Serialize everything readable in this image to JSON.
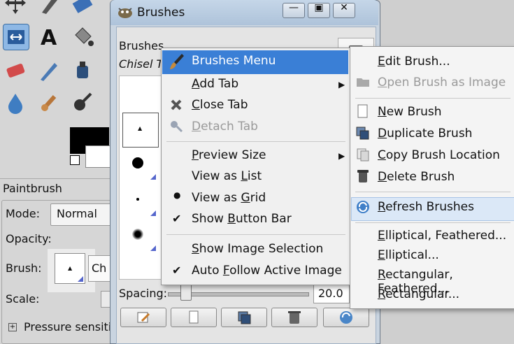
{
  "brushes_window": {
    "title": "Brushes",
    "header_label": "Brushes",
    "subheader_label": "Chisel T",
    "spacing_label": "Spacing:",
    "spacing_value": "20.0"
  },
  "tool_options": {
    "title": "Paintbrush",
    "mode_label": "Mode:",
    "mode_value": "Normal",
    "opacity_label": "Opacity:",
    "brush_label": "Brush:",
    "brush_name": "Ch",
    "scale_label": "Scale:",
    "pressure_label": "Pressure sensiti"
  },
  "context_menu": {
    "header": "Brushes Menu",
    "items": [
      {
        "label": "Add Tab",
        "mnemonic": "A",
        "rest": "dd Tab",
        "submenu": true
      },
      {
        "label": "Close Tab",
        "mnemonic": "C",
        "rest": "lose Tab"
      },
      {
        "label": "Detach Tab",
        "mnemonic": "D",
        "rest": "etach Tab",
        "disabled": true
      },
      {
        "label": "Preview Size",
        "mnemonic": "P",
        "rest": "review Size",
        "submenu": true
      },
      {
        "label": "View as List",
        "mnemonic": "L",
        "pre": "View as ",
        "rest": "ist"
      },
      {
        "label": "View as Grid",
        "mnemonic": "G",
        "pre": "View as ",
        "rest": "rid",
        "radio": true
      },
      {
        "label": "Show Button Bar",
        "mnemonic": "B",
        "pre": "Show ",
        "rest": "utton Bar",
        "checked": true
      },
      {
        "label": "Show Image Selection",
        "mnemonic": "S",
        "rest": "how Image Selection"
      },
      {
        "label": "Auto Follow Active Image",
        "mnemonic": "F",
        "pre": "Auto ",
        "rest": "ollow Active Image",
        "checked": true
      }
    ]
  },
  "brushes_submenu": {
    "items": [
      {
        "label": "Edit Brush...",
        "mnemonic": "E",
        "rest": "dit Brush..."
      },
      {
        "label": "Open Brush as Image",
        "mnemonic": "O",
        "rest": "pen Brush as Image",
        "disabled": true
      },
      {
        "label": "New Brush",
        "mnemonic": "N",
        "rest": "ew Brush"
      },
      {
        "label": "Duplicate Brush",
        "mnemonic": "D",
        "rest": "uplicate Brush"
      },
      {
        "label": "Copy Brush Location",
        "mnemonic": "C",
        "rest": "opy Brush Location"
      },
      {
        "label": "Delete Brush",
        "mnemonic": "D",
        "rest": "elete Brush"
      },
      {
        "label": "Refresh Brushes",
        "mnemonic": "R",
        "rest": "efresh Brushes",
        "highlighted": true
      },
      {
        "label": "Elliptical, Feathered...",
        "mnemonic": "E",
        "rest": "lliptical, Feathered..."
      },
      {
        "label": "Elliptical...",
        "mnemonic": "E",
        "rest": "lliptical..."
      },
      {
        "label": "Rectangular, Feathered...",
        "mnemonic": "R",
        "rest": "ectangular, Feathered..."
      },
      {
        "label": "Rectangular...",
        "mnemonic": "R",
        "rest": "ectangular..."
      }
    ]
  },
  "colors": {
    "menu_highlight": "#3a7fd6",
    "hover_highlight": "#dbe8f7"
  }
}
